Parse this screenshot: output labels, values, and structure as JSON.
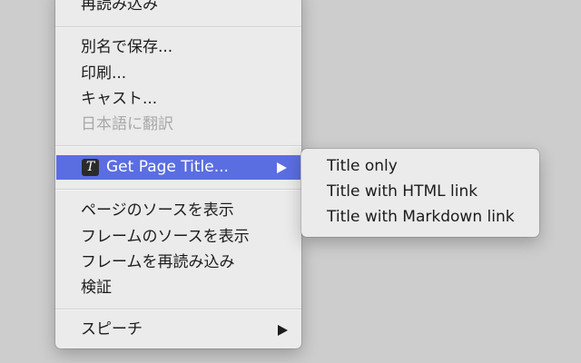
{
  "context_menu": {
    "items": [
      {
        "label": "再読み込み",
        "enabled": true
      },
      {
        "label": "別名で保存...",
        "enabled": true
      },
      {
        "label": "印刷...",
        "enabled": true
      },
      {
        "label": "キャスト...",
        "enabled": true
      },
      {
        "label": "日本語に翻訳",
        "enabled": false
      },
      {
        "label": "Get Page Title...",
        "enabled": true,
        "highlighted": true,
        "icon": "extension-icon",
        "icon_glyph": "T",
        "has_submenu": true
      },
      {
        "label": "ページのソースを表示",
        "enabled": true
      },
      {
        "label": "フレームのソースを表示",
        "enabled": true
      },
      {
        "label": "フレームを再読み込み",
        "enabled": true
      },
      {
        "label": "検証",
        "enabled": true
      },
      {
        "label": "スピーチ",
        "enabled": true,
        "has_submenu": true
      }
    ]
  },
  "submenu": {
    "items": [
      {
        "label": "Title only"
      },
      {
        "label": "Title with HTML link"
      },
      {
        "label": "Title with Markdown link"
      }
    ]
  },
  "colors": {
    "highlight": "#5b6ee1",
    "menu_background": "#ebebeb",
    "page_background": "#cdcdcd",
    "disabled_text": "#a8a8a8"
  }
}
